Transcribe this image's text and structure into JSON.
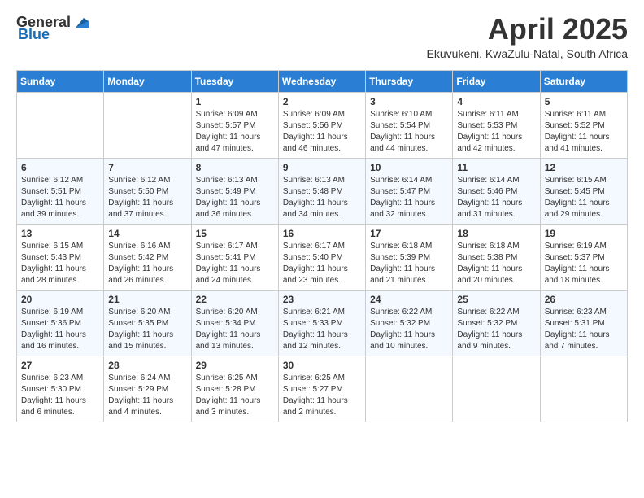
{
  "header": {
    "logo": {
      "general": "General",
      "blue": "Blue"
    },
    "title": "April 2025",
    "subtitle": "Ekuvukeni, KwaZulu-Natal, South Africa"
  },
  "columns": [
    "Sunday",
    "Monday",
    "Tuesday",
    "Wednesday",
    "Thursday",
    "Friday",
    "Saturday"
  ],
  "weeks": [
    [
      {
        "day": "",
        "sunrise": "",
        "sunset": "",
        "daylight": ""
      },
      {
        "day": "",
        "sunrise": "",
        "sunset": "",
        "daylight": ""
      },
      {
        "day": "1",
        "sunrise": "Sunrise: 6:09 AM",
        "sunset": "Sunset: 5:57 PM",
        "daylight": "Daylight: 11 hours and 47 minutes."
      },
      {
        "day": "2",
        "sunrise": "Sunrise: 6:09 AM",
        "sunset": "Sunset: 5:56 PM",
        "daylight": "Daylight: 11 hours and 46 minutes."
      },
      {
        "day": "3",
        "sunrise": "Sunrise: 6:10 AM",
        "sunset": "Sunset: 5:54 PM",
        "daylight": "Daylight: 11 hours and 44 minutes."
      },
      {
        "day": "4",
        "sunrise": "Sunrise: 6:11 AM",
        "sunset": "Sunset: 5:53 PM",
        "daylight": "Daylight: 11 hours and 42 minutes."
      },
      {
        "day": "5",
        "sunrise": "Sunrise: 6:11 AM",
        "sunset": "Sunset: 5:52 PM",
        "daylight": "Daylight: 11 hours and 41 minutes."
      }
    ],
    [
      {
        "day": "6",
        "sunrise": "Sunrise: 6:12 AM",
        "sunset": "Sunset: 5:51 PM",
        "daylight": "Daylight: 11 hours and 39 minutes."
      },
      {
        "day": "7",
        "sunrise": "Sunrise: 6:12 AM",
        "sunset": "Sunset: 5:50 PM",
        "daylight": "Daylight: 11 hours and 37 minutes."
      },
      {
        "day": "8",
        "sunrise": "Sunrise: 6:13 AM",
        "sunset": "Sunset: 5:49 PM",
        "daylight": "Daylight: 11 hours and 36 minutes."
      },
      {
        "day": "9",
        "sunrise": "Sunrise: 6:13 AM",
        "sunset": "Sunset: 5:48 PM",
        "daylight": "Daylight: 11 hours and 34 minutes."
      },
      {
        "day": "10",
        "sunrise": "Sunrise: 6:14 AM",
        "sunset": "Sunset: 5:47 PM",
        "daylight": "Daylight: 11 hours and 32 minutes."
      },
      {
        "day": "11",
        "sunrise": "Sunrise: 6:14 AM",
        "sunset": "Sunset: 5:46 PM",
        "daylight": "Daylight: 11 hours and 31 minutes."
      },
      {
        "day": "12",
        "sunrise": "Sunrise: 6:15 AM",
        "sunset": "Sunset: 5:45 PM",
        "daylight": "Daylight: 11 hours and 29 minutes."
      }
    ],
    [
      {
        "day": "13",
        "sunrise": "Sunrise: 6:15 AM",
        "sunset": "Sunset: 5:43 PM",
        "daylight": "Daylight: 11 hours and 28 minutes."
      },
      {
        "day": "14",
        "sunrise": "Sunrise: 6:16 AM",
        "sunset": "Sunset: 5:42 PM",
        "daylight": "Daylight: 11 hours and 26 minutes."
      },
      {
        "day": "15",
        "sunrise": "Sunrise: 6:17 AM",
        "sunset": "Sunset: 5:41 PM",
        "daylight": "Daylight: 11 hours and 24 minutes."
      },
      {
        "day": "16",
        "sunrise": "Sunrise: 6:17 AM",
        "sunset": "Sunset: 5:40 PM",
        "daylight": "Daylight: 11 hours and 23 minutes."
      },
      {
        "day": "17",
        "sunrise": "Sunrise: 6:18 AM",
        "sunset": "Sunset: 5:39 PM",
        "daylight": "Daylight: 11 hours and 21 minutes."
      },
      {
        "day": "18",
        "sunrise": "Sunrise: 6:18 AM",
        "sunset": "Sunset: 5:38 PM",
        "daylight": "Daylight: 11 hours and 20 minutes."
      },
      {
        "day": "19",
        "sunrise": "Sunrise: 6:19 AM",
        "sunset": "Sunset: 5:37 PM",
        "daylight": "Daylight: 11 hours and 18 minutes."
      }
    ],
    [
      {
        "day": "20",
        "sunrise": "Sunrise: 6:19 AM",
        "sunset": "Sunset: 5:36 PM",
        "daylight": "Daylight: 11 hours and 16 minutes."
      },
      {
        "day": "21",
        "sunrise": "Sunrise: 6:20 AM",
        "sunset": "Sunset: 5:35 PM",
        "daylight": "Daylight: 11 hours and 15 minutes."
      },
      {
        "day": "22",
        "sunrise": "Sunrise: 6:20 AM",
        "sunset": "Sunset: 5:34 PM",
        "daylight": "Daylight: 11 hours and 13 minutes."
      },
      {
        "day": "23",
        "sunrise": "Sunrise: 6:21 AM",
        "sunset": "Sunset: 5:33 PM",
        "daylight": "Daylight: 11 hours and 12 minutes."
      },
      {
        "day": "24",
        "sunrise": "Sunrise: 6:22 AM",
        "sunset": "Sunset: 5:32 PM",
        "daylight": "Daylight: 11 hours and 10 minutes."
      },
      {
        "day": "25",
        "sunrise": "Sunrise: 6:22 AM",
        "sunset": "Sunset: 5:32 PM",
        "daylight": "Daylight: 11 hours and 9 minutes."
      },
      {
        "day": "26",
        "sunrise": "Sunrise: 6:23 AM",
        "sunset": "Sunset: 5:31 PM",
        "daylight": "Daylight: 11 hours and 7 minutes."
      }
    ],
    [
      {
        "day": "27",
        "sunrise": "Sunrise: 6:23 AM",
        "sunset": "Sunset: 5:30 PM",
        "daylight": "Daylight: 11 hours and 6 minutes."
      },
      {
        "day": "28",
        "sunrise": "Sunrise: 6:24 AM",
        "sunset": "Sunset: 5:29 PM",
        "daylight": "Daylight: 11 hours and 4 minutes."
      },
      {
        "day": "29",
        "sunrise": "Sunrise: 6:25 AM",
        "sunset": "Sunset: 5:28 PM",
        "daylight": "Daylight: 11 hours and 3 minutes."
      },
      {
        "day": "30",
        "sunrise": "Sunrise: 6:25 AM",
        "sunset": "Sunset: 5:27 PM",
        "daylight": "Daylight: 11 hours and 2 minutes."
      },
      {
        "day": "",
        "sunrise": "",
        "sunset": "",
        "daylight": ""
      },
      {
        "day": "",
        "sunrise": "",
        "sunset": "",
        "daylight": ""
      },
      {
        "day": "",
        "sunrise": "",
        "sunset": "",
        "daylight": ""
      }
    ]
  ]
}
